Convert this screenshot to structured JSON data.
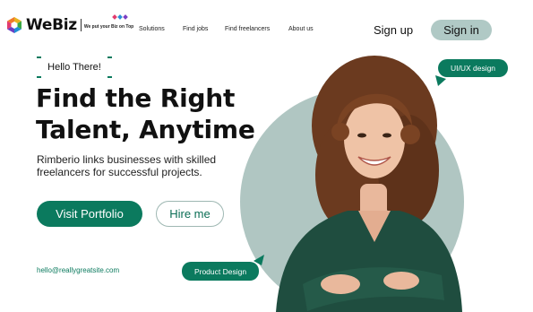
{
  "brand": {
    "name": "WeBiz",
    "tagline": "We put your Biz on Top",
    "icon": "hexagon-logo-icon",
    "dot_colors": [
      "#e23b6f",
      "#2a8fd6",
      "#7b3fc4"
    ]
  },
  "nav": {
    "items": [
      {
        "label": "Solutions"
      },
      {
        "label": "Find jobs"
      },
      {
        "label": "Find freelancers"
      },
      {
        "label": "About us"
      }
    ]
  },
  "auth": {
    "signup_label": "Sign up",
    "signin_label": "Sign in"
  },
  "hero": {
    "greeting": "Hello There!",
    "headline_line1": "Find the Right",
    "headline_line2": "Talent, Anytime",
    "subtext": "Rimberio links businesses with skilled freelancers for successful projects.",
    "primary_cta": "Visit Portfolio",
    "secondary_cta": "Hire me",
    "email": "hello@reallygreatsite.com",
    "tag_top": "UI/UX design",
    "tag_bottom": "Product Design"
  },
  "colors": {
    "accent": "#0b7a5e",
    "blob": "#b0c6c2",
    "signin_bg": "#b0c9c5"
  }
}
